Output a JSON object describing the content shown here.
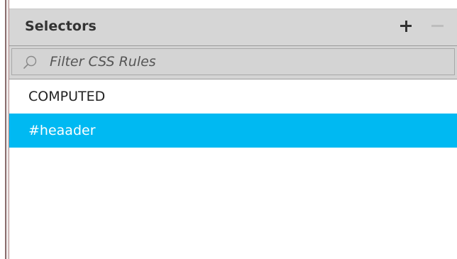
{
  "panel": {
    "title": "Selectors",
    "add_icon": "plus-icon",
    "remove_icon": "minus-icon"
  },
  "filter": {
    "placeholder": "Filter CSS Rules",
    "value": "",
    "icon": "search-icon"
  },
  "selectors": [
    {
      "label": "COMPUTED",
      "selected": false
    },
    {
      "label": "#heaader",
      "selected": true
    }
  ],
  "colors": {
    "header_bg": "#d6d6d6",
    "selected_bg": "#00b9f2",
    "selected_text": "#ffffff",
    "remove_disabled": "#bdbdbd"
  }
}
